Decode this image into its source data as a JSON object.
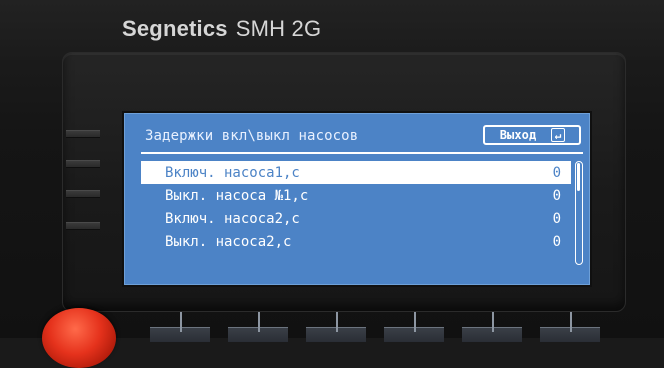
{
  "device": {
    "brand": "Segnetics",
    "model": "SMH 2G"
  },
  "screen": {
    "title": "Задержки вкл\\выкл насосов",
    "exit_button_label": "Выход",
    "rows": [
      {
        "label": "Включ. насоса1,с",
        "value": "0",
        "selected": true
      },
      {
        "label": "Выкл. насоса №1,с",
        "value": "0",
        "selected": false
      },
      {
        "label": "Включ. насоса2,с",
        "value": "0",
        "selected": false
      },
      {
        "label": "Выкл. насоса2,с",
        "value": "0",
        "selected": false
      }
    ],
    "scroll_position": 0.0
  },
  "colors": {
    "screen_bg": "#4c83c6",
    "text": "#ffffff",
    "selection_bg": "#ffffff",
    "stop_button": "#e5321c"
  },
  "icons": {
    "exit": "return-icon",
    "stop": "red-button"
  }
}
